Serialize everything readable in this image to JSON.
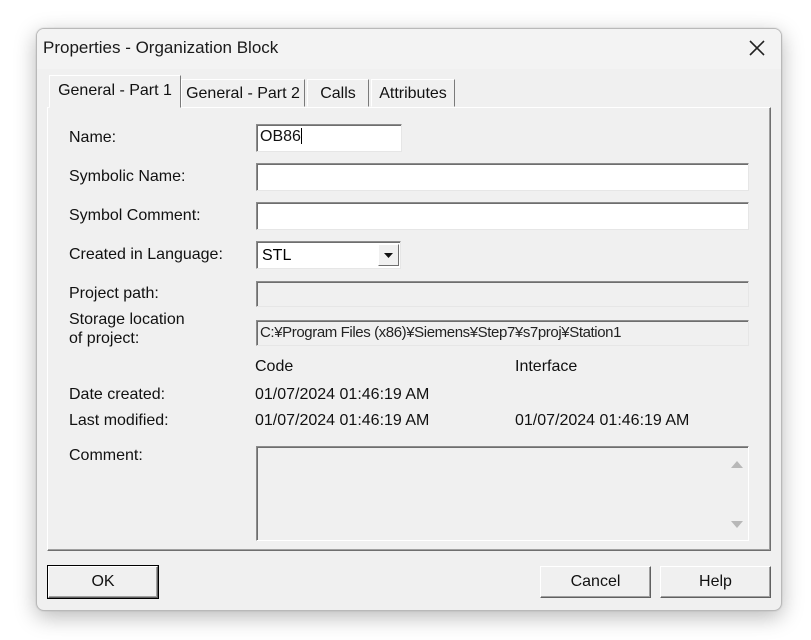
{
  "window": {
    "title": "Properties - Organization Block"
  },
  "tabs": [
    {
      "label": "General - Part 1",
      "active": true
    },
    {
      "label": "General - Part 2",
      "active": false
    },
    {
      "label": "Calls",
      "active": false
    },
    {
      "label": "Attributes",
      "active": false
    }
  ],
  "form": {
    "name": {
      "label": "Name:",
      "value": "OB86"
    },
    "symbolic_name": {
      "label": "Symbolic Name:",
      "value": ""
    },
    "symbol_comment": {
      "label": "Symbol Comment:",
      "value": ""
    },
    "language": {
      "label": "Created in Language:",
      "value": "STL"
    },
    "project_path": {
      "label": "Project path:",
      "value": ""
    },
    "storage": {
      "label_line1": "Storage location",
      "label_line2": "of project:",
      "value": "C:¥Program Files (x86)¥Siemens¥Step7¥s7proj¥Station1"
    },
    "columns": {
      "code": "Code",
      "interface": "Interface"
    },
    "date_created": {
      "label": "Date created:",
      "code": "01/07/2024 01:46:19 AM",
      "interface": ""
    },
    "last_modified": {
      "label": "Last modified:",
      "code": "01/07/2024 01:46:19 AM",
      "interface": "01/07/2024 01:46:19 AM"
    },
    "comment": {
      "label": "Comment:",
      "value": ""
    }
  },
  "buttons": {
    "ok": "OK",
    "cancel": "Cancel",
    "help": "Help"
  }
}
